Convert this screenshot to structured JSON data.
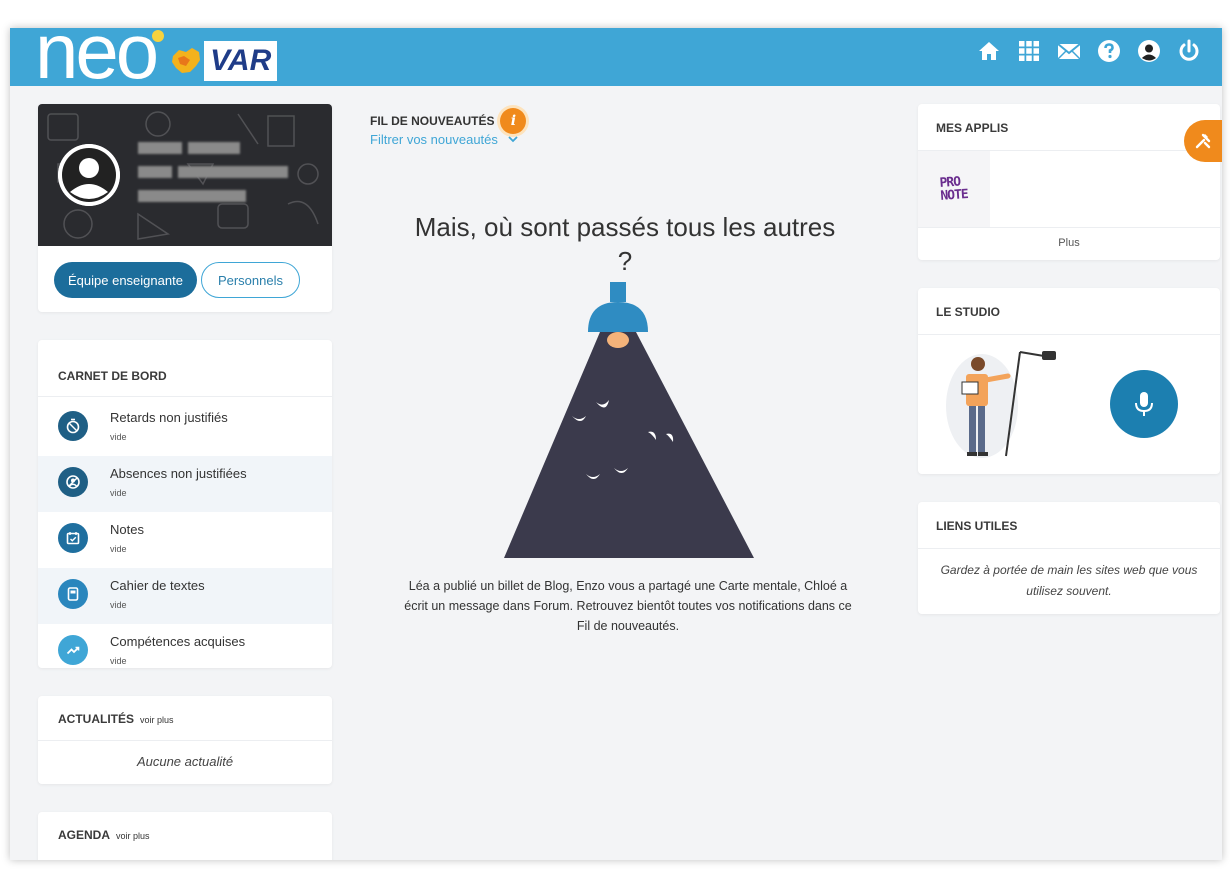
{
  "header": {
    "logo_text": "neo",
    "logo_region": "VAR",
    "icons": [
      "home-icon",
      "apps-grid-icon",
      "mail-icon",
      "help-icon",
      "account-icon",
      "power-icon"
    ]
  },
  "profile": {
    "buttons": {
      "primary": "Équipe enseignante",
      "secondary": "Personnels"
    }
  },
  "carnet": {
    "title": "CARNET DE BORD",
    "items": [
      {
        "label": "Retards non justifiés",
        "sub": "vide",
        "icon": "stopwatch-icon",
        "color": "#1f5f85"
      },
      {
        "label": "Absences non justifiées",
        "sub": "vide",
        "icon": "absence-icon",
        "color": "#1f5f85"
      },
      {
        "label": "Notes",
        "sub": "vide",
        "icon": "calendar-check-icon",
        "color": "#1f6f9f"
      },
      {
        "label": "Cahier de textes",
        "sub": "vide",
        "icon": "notebook-icon",
        "color": "#2a86bd"
      },
      {
        "label": "Compétences acquises",
        "sub": "vide",
        "icon": "trend-icon",
        "color": "#3fa6d6"
      }
    ]
  },
  "actualites": {
    "title": "ACTUALITÉS",
    "voir_plus": "voir plus",
    "empty": "Aucune actualité"
  },
  "agenda": {
    "title": "AGENDA",
    "voir_plus": "voir plus"
  },
  "feed": {
    "title": "FIL DE NOUVEAUTÉS",
    "filter": "Filtrer vos nouveautés",
    "empty_heading": "Mais, où sont passés tous les autres ?",
    "empty_text": "Léa a publié un billet de Blog, Enzo vous a partagé une Carte mentale, Chloé a écrit un message dans Forum. Retrouvez bientôt toutes vos notifications dans ce Fil de nouveautés."
  },
  "applis": {
    "title": "MES APPLIS",
    "app_name": "PRONOTE",
    "app_line1": "PRO",
    "app_line2": "NOTE",
    "more": "Plus"
  },
  "studio": {
    "title": "LE STUDIO"
  },
  "liens": {
    "title": "LIENS UTILES",
    "text": "Gardez à portée de main les sites web que vous utilisez souvent."
  },
  "colors": {
    "header": "#3fa6d6",
    "primary": "#1c6d9b",
    "accent": "#f08a1c"
  }
}
